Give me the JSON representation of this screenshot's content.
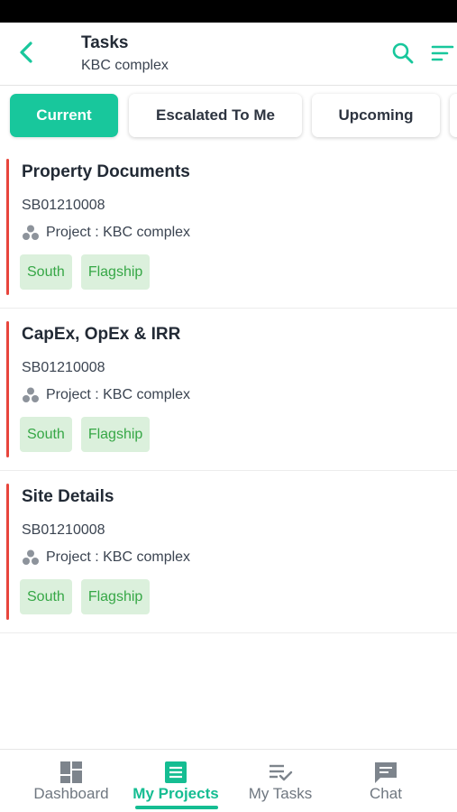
{
  "header": {
    "title": "Tasks",
    "subtitle": "KBC complex",
    "back_icon": "chevron-left-icon",
    "search_icon": "search-icon",
    "filter_icon": "filter-lines-icon",
    "accent_color": "#18c79c"
  },
  "tabs": [
    {
      "label": "Current",
      "active": true
    },
    {
      "label": "Escalated To Me",
      "active": false
    },
    {
      "label": "Upcoming",
      "active": false
    },
    {
      "label": "",
      "active": false
    }
  ],
  "tasks": [
    {
      "title": "Property Documents",
      "code": "SB01210008",
      "project": "Project : KBC complex",
      "tags": [
        "South",
        "Flagship"
      ],
      "priority_color": "#e8453c"
    },
    {
      "title": "CapEx, OpEx & IRR",
      "code": "SB01210008",
      "project": "Project : KBC complex",
      "tags": [
        "South",
        "Flagship"
      ],
      "priority_color": "#e8453c"
    },
    {
      "title": "Site Details",
      "code": "SB01210008",
      "project": "Project : KBC complex",
      "tags": [
        "South",
        "Flagship"
      ],
      "priority_color": "#e8453c"
    }
  ],
  "bottom_nav": [
    {
      "label": "Dashboard",
      "icon": "dashboard-icon",
      "active": false
    },
    {
      "label": "My Projects",
      "icon": "projects-icon",
      "active": true
    },
    {
      "label": "My Tasks",
      "icon": "tasks-checklist-icon",
      "active": false
    },
    {
      "label": "Chat",
      "icon": "chat-icon",
      "active": false
    }
  ]
}
